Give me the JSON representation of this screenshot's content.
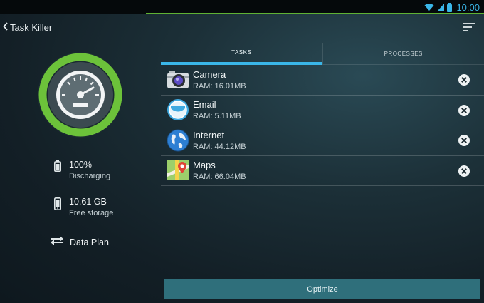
{
  "status": {
    "time": "10:00"
  },
  "header": {
    "title": "Task Killer"
  },
  "device": {
    "battery_value": "100%",
    "battery_label": "Discharging",
    "storage_value": "10.61 GB",
    "storage_label": "Free storage",
    "dataplan_label": "Data Plan"
  },
  "tabs": [
    {
      "label": "TASKS",
      "active": true
    },
    {
      "label": "PROCESSES",
      "active": false
    }
  ],
  "apps": [
    {
      "name": "Camera",
      "ram": "RAM: 16.01MB",
      "icon": "camera-icon"
    },
    {
      "name": "Email",
      "ram": "RAM: 5.11MB",
      "icon": "email-icon"
    },
    {
      "name": "Internet",
      "ram": "RAM: 44.12MB",
      "icon": "globe-icon"
    },
    {
      "name": "Maps",
      "ram": "RAM: 66.04MB",
      "icon": "maps-icon"
    }
  ],
  "actions": {
    "optimize_label": "Optimize"
  },
  "colors": {
    "accent_blue": "#3ab6e8",
    "accent_green": "#5fb233",
    "button_teal": "#2f6f7b"
  }
}
